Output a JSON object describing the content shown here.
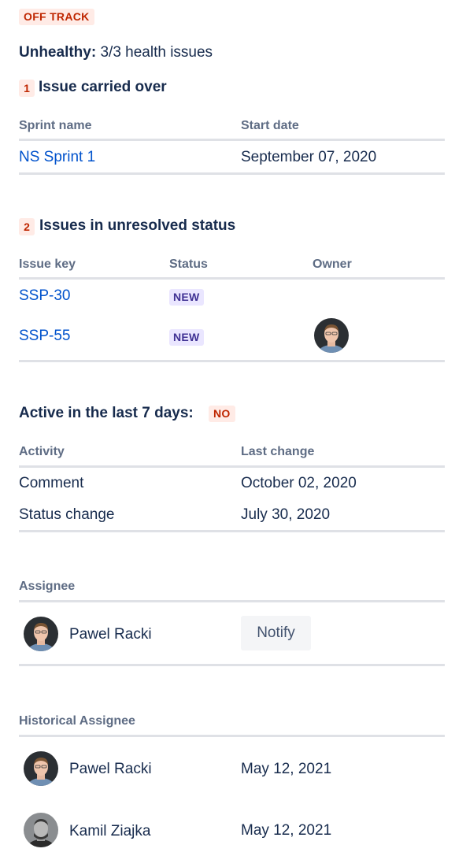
{
  "status": {
    "label": "OFF TRACK"
  },
  "health": {
    "label": "Unhealthy:",
    "value": "3/3 health issues"
  },
  "section1": {
    "number": "1",
    "title": "Issue carried over",
    "headers": [
      "Sprint name",
      "Start date"
    ],
    "rows": [
      {
        "name": "NS Sprint 1",
        "date": "September 07, 2020"
      }
    ]
  },
  "section2": {
    "number": "2",
    "title": "Issues in unresolved status",
    "headers": [
      "Issue key",
      "Status",
      "Owner"
    ],
    "rows": [
      {
        "key": "SSP-30",
        "status": "NEW"
      },
      {
        "key": "SSP-55",
        "status": "NEW"
      }
    ]
  },
  "activity": {
    "title": "Active in the last 7 days:",
    "badge": "NO",
    "headers": [
      "Activity",
      "Last change"
    ],
    "rows": [
      {
        "activity": "Comment",
        "date": "October 02, 2020"
      },
      {
        "activity": "Status change",
        "date": "July 30, 2020"
      }
    ]
  },
  "assignee": {
    "title": "Assignee",
    "name": "Pawel Racki",
    "notify_label": "Notify"
  },
  "historical": {
    "title": "Historical Assignee",
    "rows": [
      {
        "name": "Pawel Racki",
        "date": "May 12, 2021"
      },
      {
        "name": "Kamil Ziajka",
        "date": "May 12, 2021"
      }
    ]
  },
  "colors": {
    "link": "#0052cc",
    "text": "#172b4d",
    "muted": "#5e6c84",
    "red_bg": "#ffebe6",
    "red_fg": "#bf2600",
    "purple_bg": "#eae6ff",
    "purple_fg": "#403294"
  }
}
